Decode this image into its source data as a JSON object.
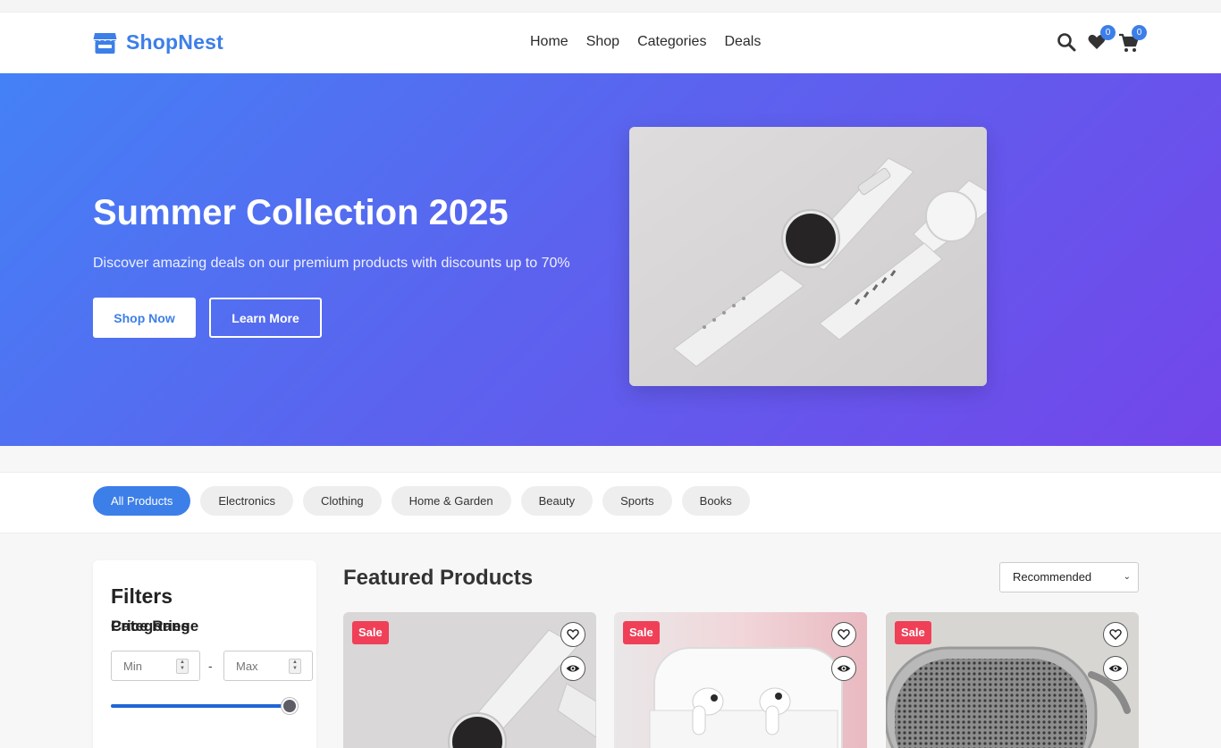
{
  "brand": {
    "name": "ShopNest",
    "accent": "#3d7fe8"
  },
  "nav": {
    "items": [
      "Home",
      "Shop",
      "Categories",
      "Deals"
    ]
  },
  "header_icons": {
    "search": "search-icon",
    "wishlist": "heart-icon",
    "wishlist_count": "0",
    "cart": "cart-icon",
    "cart_count": "0"
  },
  "hero": {
    "title": "Summer Collection 2025",
    "subtitle": "Discover amazing deals on our premium products with discounts up to 70%",
    "primary_button": "Shop Now",
    "secondary_button": "Learn More",
    "gradient": [
      "#4481f6",
      "#7346ea"
    ]
  },
  "categories": {
    "chips": [
      "All Products",
      "Electronics",
      "Clothing",
      "Home & Garden",
      "Beauty",
      "Sports",
      "Books"
    ],
    "active": "All Products"
  },
  "filters": {
    "title": "Filters",
    "price_range_label": "Price Range",
    "min_placeholder": "Min",
    "max_placeholder": "Max",
    "separator": "-",
    "slider_value": 1.0,
    "categories_label": "Categories"
  },
  "products": {
    "title": "Featured Products",
    "sort_selected": "Recommended",
    "cards": [
      {
        "badge": "Sale",
        "image": "white-smartwatch",
        "wishlist": "heart-icon",
        "quickview": "eye-icon"
      },
      {
        "badge": "Sale",
        "image": "wireless-earbuds",
        "wishlist": "heart-icon",
        "quickview": "eye-icon"
      },
      {
        "badge": "Sale",
        "image": "portable-speaker",
        "wishlist": "heart-icon",
        "quickview": "eye-icon"
      }
    ]
  }
}
